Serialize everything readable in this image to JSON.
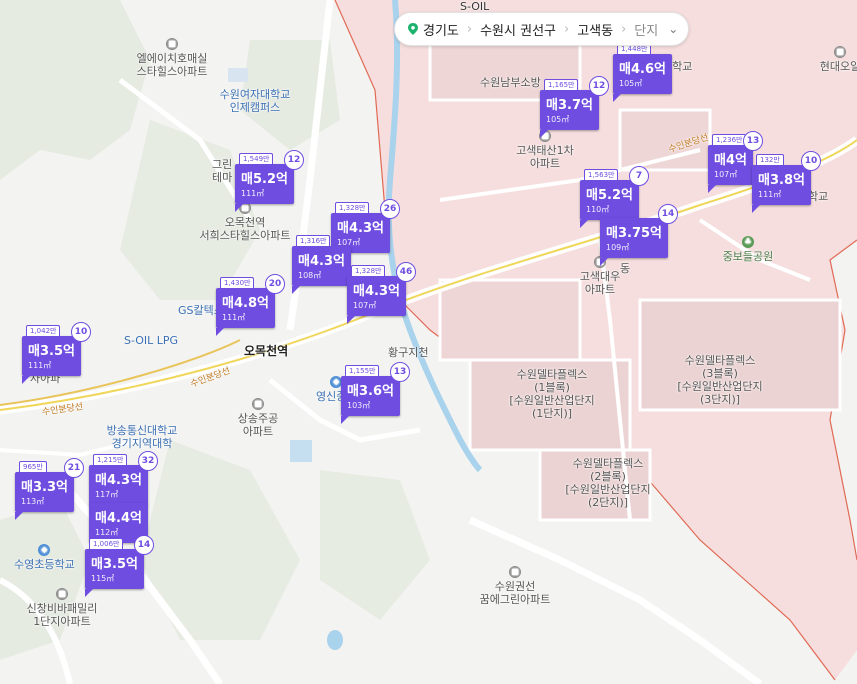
{
  "breadcrumb": {
    "province": "경기도",
    "city": "수원시 권선구",
    "dong": "고색동",
    "type": "단지"
  },
  "places": {
    "soil_top": "S-OIL",
    "ehs": "엘에이치호매실\n스타힐스아파트",
    "wonyeo": "수원여자대학교\n인제캠퍼스",
    "green_partial": "그린\n테마",
    "omok_seohui": "오목천역\n서희스타힐스아파트",
    "gs": "GS칼텍스",
    "soil_lpg": "S-OIL LPG",
    "omokcheon_station": "오목천역",
    "yeongsin": "영신중학",
    "sangsong": "상송주공\n아파트",
    "bangsong": "방송통신대학교\n경기지역대학",
    "suyeong": "수영초등학교",
    "sinchang": "신창비바패밀리\n1단지아파트",
    "hwangguji": "황구지천",
    "suwonnambu": "수원남부소방",
    "gosaek_taesan": "고색태산1차\n아파트",
    "gosaek_daewoo": "고색대우\n아파트",
    "jungbodeul": "중보들공원",
    "hyundai": "현대오일",
    "delta3": "수원델타플렉스\n(3블록)\n[수원일반산업단지\n(3단지)]",
    "delta1": "수원델타플렉스\n(1블록)\n[수원일반산업단지\n(1단지)]",
    "delta2": "수원델타플렉스\n(2블록)\n[수원일반산업단지\n(2단지)]",
    "kkumegreen": "수원권선\n꿈에그린아파트",
    "suinbundang": "수인분당선",
    "deung_school": "등학교",
    "hakgyo": "학교",
    "ja_partial": "자아파",
    "dong_partial": "동"
  },
  "markers": [
    {
      "id": "m1",
      "ppm": "1,549만",
      "count": "12",
      "price": "매5.2억",
      "area": "111㎡"
    },
    {
      "id": "m2",
      "ppm": "1,328만",
      "count": "26",
      "price": "매4.3억",
      "area": "107㎡"
    },
    {
      "id": "m3",
      "ppm": "1,316만",
      "count": "",
      "price": "매4.3억",
      "area": "108㎡"
    },
    {
      "id": "m4",
      "ppm": "1,328만",
      "count": "46",
      "price": "매4.3억",
      "area": "107㎡"
    },
    {
      "id": "m5",
      "ppm": "1,430만",
      "count": "20",
      "price": "매4.8억",
      "area": "111㎡"
    },
    {
      "id": "m6",
      "ppm": "1,042만",
      "count": "10",
      "price": "매3.5억",
      "area": "111㎡"
    },
    {
      "id": "m7",
      "ppm": "1,155만",
      "count": "13",
      "price": "매3.6억",
      "area": "103㎡"
    },
    {
      "id": "m8",
      "ppm": "965만",
      "count": "21",
      "price": "매3.3억",
      "area": "113㎡"
    },
    {
      "id": "m9",
      "ppm": "1,215만",
      "count": "32",
      "price": "매4.3억",
      "area": "117㎡"
    },
    {
      "id": "m10",
      "ppm": "",
      "count": "",
      "price": "매4.4억",
      "area": "112㎡"
    },
    {
      "id": "m11",
      "ppm": "1,006만",
      "count": "14",
      "price": "매3.5억",
      "area": "115㎡"
    },
    {
      "id": "m12",
      "ppm": "1,165만",
      "count": "12",
      "price": "매3.7억",
      "area": "105㎡"
    },
    {
      "id": "m13",
      "ppm": "1,448만",
      "count": "",
      "price": "매4.6억",
      "area": "105㎡"
    },
    {
      "id": "m14",
      "ppm": "1,563만",
      "count": "7",
      "price": "매5.2억",
      "area": "110㎡"
    },
    {
      "id": "m15",
      "ppm": "",
      "count": "14",
      "price": "매3.75억",
      "area": "109㎡"
    },
    {
      "id": "m16",
      "ppm": "1,236만",
      "count": "13",
      "price": "매4억",
      "area": "107㎡"
    },
    {
      "id": "m17",
      "ppm": "132만",
      "count": "10",
      "price": "매3.8억",
      "area": "111㎡"
    }
  ]
}
